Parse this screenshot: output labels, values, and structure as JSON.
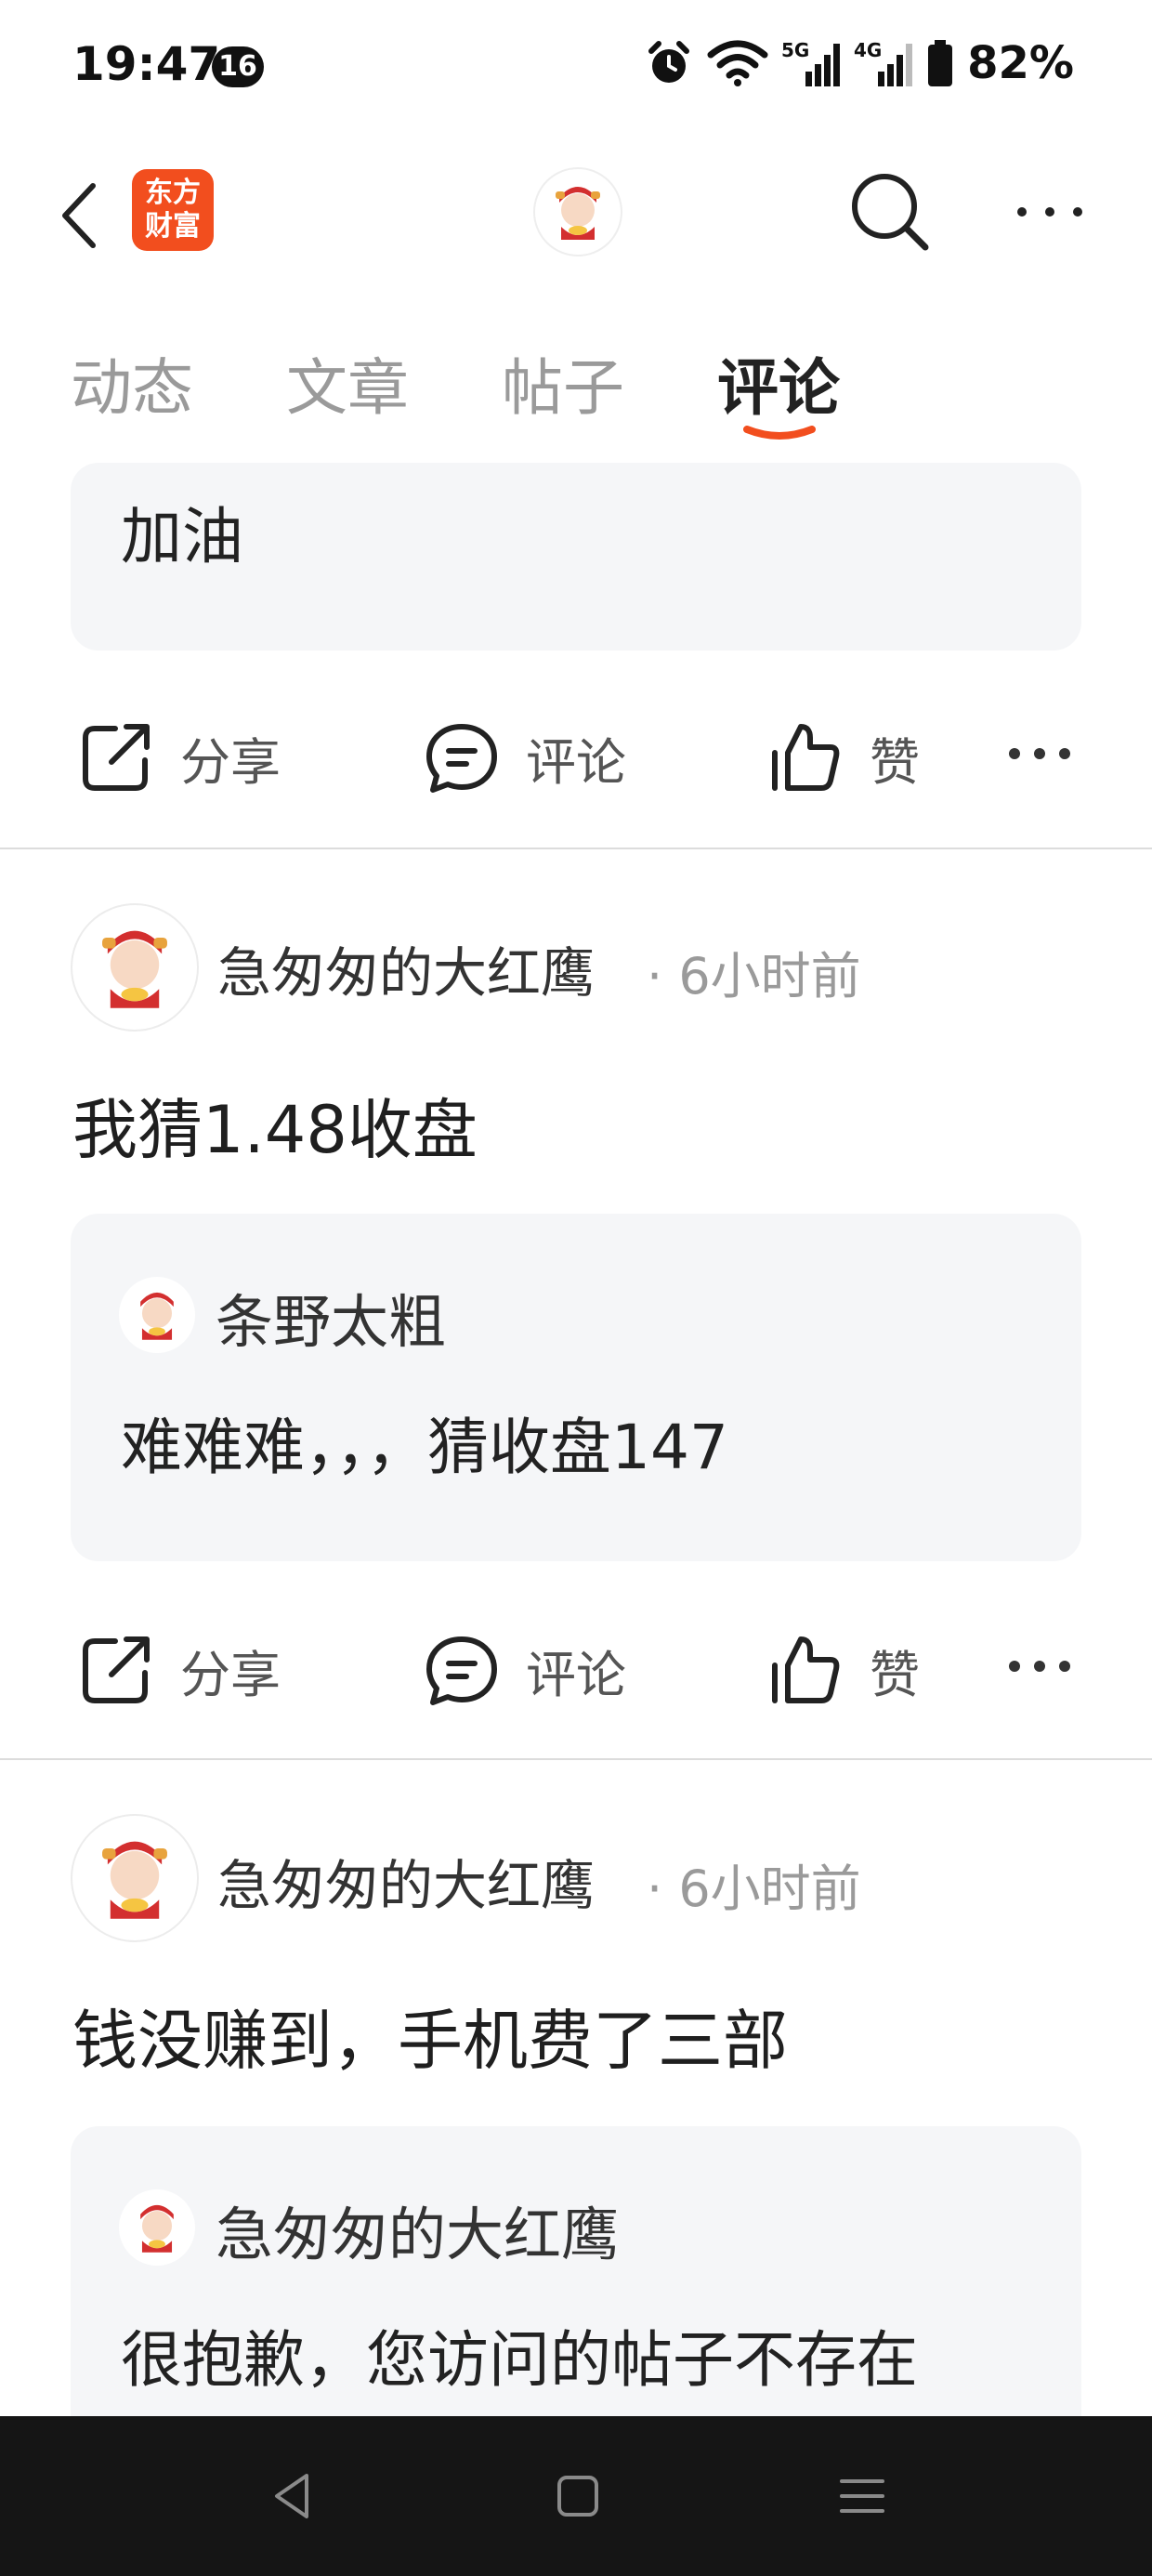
{
  "status_bar": {
    "time": "19:47",
    "notification_count": "16",
    "battery": "82%",
    "icons": [
      "alarm-icon",
      "wifi-icon",
      "signal-5g-icon",
      "signal-4g-icon",
      "battery-icon"
    ]
  },
  "top_nav": {
    "logo_line1": "东方",
    "logo_line2": "财富",
    "icons": [
      "back-icon",
      "search-icon",
      "more-icon"
    ]
  },
  "tabs": [
    {
      "label": "动态"
    },
    {
      "label": "文章"
    },
    {
      "label": "帖子"
    },
    {
      "label": "评论",
      "active": true
    }
  ],
  "colors": {
    "accent": "#f24e1e",
    "quote_bg": "#f5f6f8",
    "navbar": "#151515"
  },
  "posts": [
    {
      "quote": {
        "text": "加油"
      },
      "actions": {
        "share": "分享",
        "comment": "评论",
        "like": "赞"
      }
    },
    {
      "author": "急匆匆的大红鹰",
      "time": "· 6小时前",
      "text": "我猜1.48收盘",
      "reply": {
        "author": "条野太粗",
        "text": "难难难，，，猜收盘147"
      },
      "actions": {
        "share": "分享",
        "comment": "评论",
        "like": "赞"
      }
    },
    {
      "author": "急匆匆的大红鹰",
      "time": "· 6小时前",
      "text": "钱没赚到，手机费了三部",
      "reply": {
        "author": "急匆匆的大红鹰",
        "text": "很抱歉，您访问的帖子不存在"
      }
    }
  ]
}
